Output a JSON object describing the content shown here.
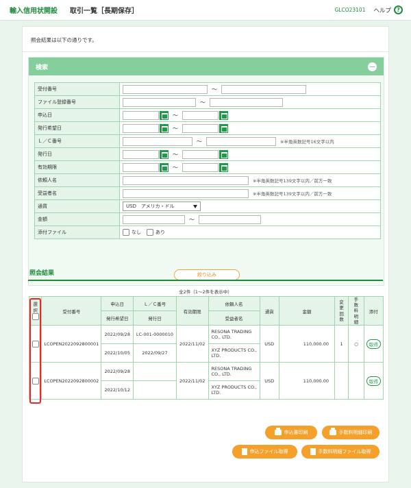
{
  "header": {
    "app_title": "輸入信用状開設",
    "page_title": "取引一覧［長期保存］",
    "screen_id": "GLCO23101",
    "help_label": "ヘルプ",
    "help_icon": "?"
  },
  "intro_text": "照会結果は以下の通りです。",
  "search": {
    "title": "検索",
    "tilde": "〜",
    "labels": {
      "receipt_no": "受付番号",
      "file_reg_no": "ファイル登録番号",
      "apply_date": "申込日",
      "issue_hope_date": "発行希望日",
      "lc_no": "Ｌ／Ｃ番号",
      "issue_date": "発行日",
      "expiry": "有効期限",
      "applicant": "依頼人名",
      "beneficiary": "受益者名",
      "currency": "通貨",
      "amount": "金額",
      "attachment": "添付ファイル"
    },
    "notes": {
      "lc_no": "※半角英数記号16文字以内",
      "applicant": "※半角英数記号139文字以内／前方一致",
      "beneficiary": "※半角英数記号139文字以内／前方一致"
    },
    "currency_value": "USD　アメリカ・ドル",
    "attachment_none": "なし",
    "attachment_yes": "あり",
    "filter_button": "絞り込み"
  },
  "results": {
    "title": "照会結果",
    "count_text": "全2件（1〜2件を表示中）",
    "headers": {
      "select": "選択",
      "receipt_no": "受付番号",
      "apply_date": "申込日",
      "issue_hope_date": "発行希望日",
      "lc_no": "Ｌ／Ｃ番号",
      "issue_date": "発行日",
      "expiry": "有効期限",
      "applicant": "依頼人名",
      "beneficiary": "受益者名",
      "currency": "通貨",
      "amount": "金額",
      "change_count": "変更回数",
      "fee_detail": "手数料明細",
      "attachment": "添付"
    },
    "rows": [
      {
        "receipt_no": "LCOPEN2022092800001",
        "apply_date": "2022/09/28",
        "issue_hope_date": "2022/10/05",
        "lc_no": "LC-001-0000010",
        "issue_date": "2022/09/27",
        "expiry": "2022/11/02",
        "applicant": "RESONA TRADING CO., LTD.",
        "beneficiary": "XYZ PRODUCTS CO., LTD.",
        "currency": "USD",
        "amount": "110,000.00",
        "change_count": "1",
        "fee_detail": "○",
        "attach_btn": "取得"
      },
      {
        "receipt_no": "LCOPEN2022092800002",
        "apply_date": "2022/09/28",
        "issue_hope_date": "2022/10/12",
        "lc_no": "",
        "issue_date": "",
        "expiry": "2022/11/02",
        "applicant": "RESONA TRADING CO., LTD.",
        "beneficiary": "XYZ PRODUCTS CO., LTD.",
        "currency": "USD",
        "amount": "110,000.00",
        "change_count": "",
        "fee_detail": "",
        "attach_btn": "取得"
      }
    ]
  },
  "actions": {
    "print_application": "申込書印刷",
    "print_fee_detail": "手数料明細印刷",
    "get_application_file": "申込ファイル取得",
    "get_fee_detail_file": "手数料明細ファイル取得"
  },
  "colors": {
    "brand_green": "#1f8a3a",
    "header_green": "#86cf9c",
    "action_orange": "#f5a02a",
    "highlight_red": "#e8262b"
  }
}
